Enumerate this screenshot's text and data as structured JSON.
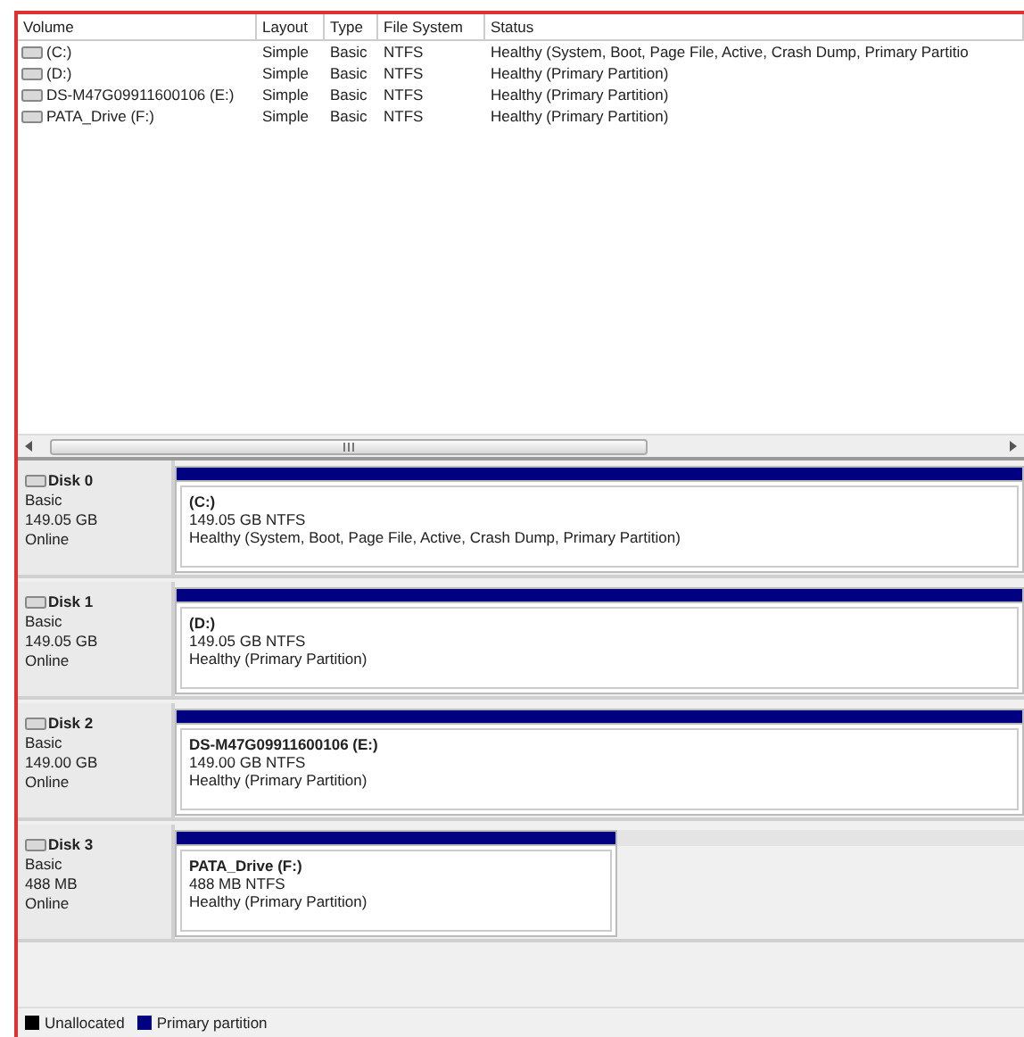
{
  "volumes": {
    "columns": [
      "Volume",
      "Layout",
      "Type",
      "File System",
      "Status"
    ],
    "rows": [
      {
        "cells": [
          "(C:)",
          "Simple",
          "Basic",
          "NTFS",
          "Healthy (System, Boot, Page File, Active, Crash Dump, Primary Partitio"
        ]
      },
      {
        "cells": [
          "(D:)",
          "Simple",
          "Basic",
          "NTFS",
          "Healthy (Primary Partition)"
        ]
      },
      {
        "cells": [
          "DS-M47G09911600106 (E:)",
          "Simple",
          "Basic",
          "NTFS",
          "Healthy (Primary Partition)"
        ]
      },
      {
        "cells": [
          "PATA_Drive (F:)",
          "Simple",
          "Basic",
          "NTFS",
          "Healthy (Primary Partition)"
        ]
      }
    ]
  },
  "disks": [
    {
      "name": "Disk 0",
      "type": "Basic",
      "size": "149.05 GB",
      "state": "Online",
      "partitions": [
        {
          "label": "(C:)",
          "size": "149.05 GB NTFS",
          "status": "Healthy (System, Boot, Page File, Active, Crash Dump, Primary Partition)",
          "level": 1
        }
      ]
    },
    {
      "name": "Disk 1",
      "type": "Basic",
      "size": "149.05 GB",
      "state": "Online",
      "partitions": [
        {
          "label": "(D:)",
          "size": "149.05 GB NTFS",
          "status": "Healthy (Primary Partition)",
          "level": 1
        }
      ]
    },
    {
      "name": "Disk 2",
      "type": "Basic",
      "size": "149.00 GB",
      "state": "Online",
      "partitions": [
        {
          "label": "DS-M47G09911600106  (E:)",
          "size": "149.00 GB NTFS",
          "status": "Healthy (Primary Partition)",
          "level": 1
        }
      ]
    },
    {
      "name": "Disk 3",
      "type": "Basic",
      "size": "488 MB",
      "state": "Online",
      "partitions": [
        {
          "label": "PATA_Drive  (F:)",
          "size": "488 MB NTFS",
          "status": "Healthy (Primary Partition)",
          "level": 0.52
        }
      ]
    }
  ],
  "legend": [
    {
      "label": "Unallocated",
      "color": "#000000"
    },
    {
      "label": "Primary partition",
      "color": "#000080"
    }
  ]
}
